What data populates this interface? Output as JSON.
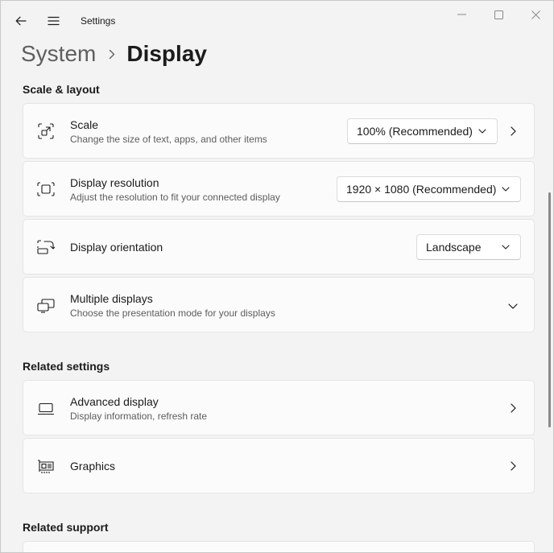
{
  "window": {
    "title": "Settings"
  },
  "breadcrumb": {
    "parent": "System",
    "current": "Display"
  },
  "sections": {
    "scale_layout": "Scale & layout",
    "related_settings": "Related settings",
    "related_support": "Related support"
  },
  "scale": {
    "title": "Scale",
    "desc": "Change the size of text, apps, and other items",
    "value": "100% (Recommended)"
  },
  "resolution": {
    "title": "Display resolution",
    "desc": "Adjust the resolution to fit your connected display",
    "value": "1920 × 1080 (Recommended)"
  },
  "orientation": {
    "title": "Display orientation",
    "value": "Landscape"
  },
  "multiple": {
    "title": "Multiple displays",
    "desc": "Choose the presentation mode for your displays"
  },
  "advanced": {
    "title": "Advanced display",
    "desc": "Display information, refresh rate"
  },
  "graphics": {
    "title": "Graphics"
  },
  "icons": {
    "back": "back-arrow-icon",
    "menu": "hamburger-menu-icon",
    "minimize": "minimize-icon",
    "maximize": "maximize-icon",
    "close": "close-icon",
    "scale": "scale-icon",
    "resolution": "resolution-icon",
    "orientation": "rotate-display-icon",
    "multiple": "multiple-displays-icon",
    "advanced": "laptop-icon",
    "graphics": "graphics-card-icon"
  },
  "colors": {
    "background": "#f3f3f3",
    "card": "#fbfbfb",
    "border": "#e5e5e5",
    "text": "#1b1b1b",
    "secondary_text": "#5d5d5d"
  }
}
